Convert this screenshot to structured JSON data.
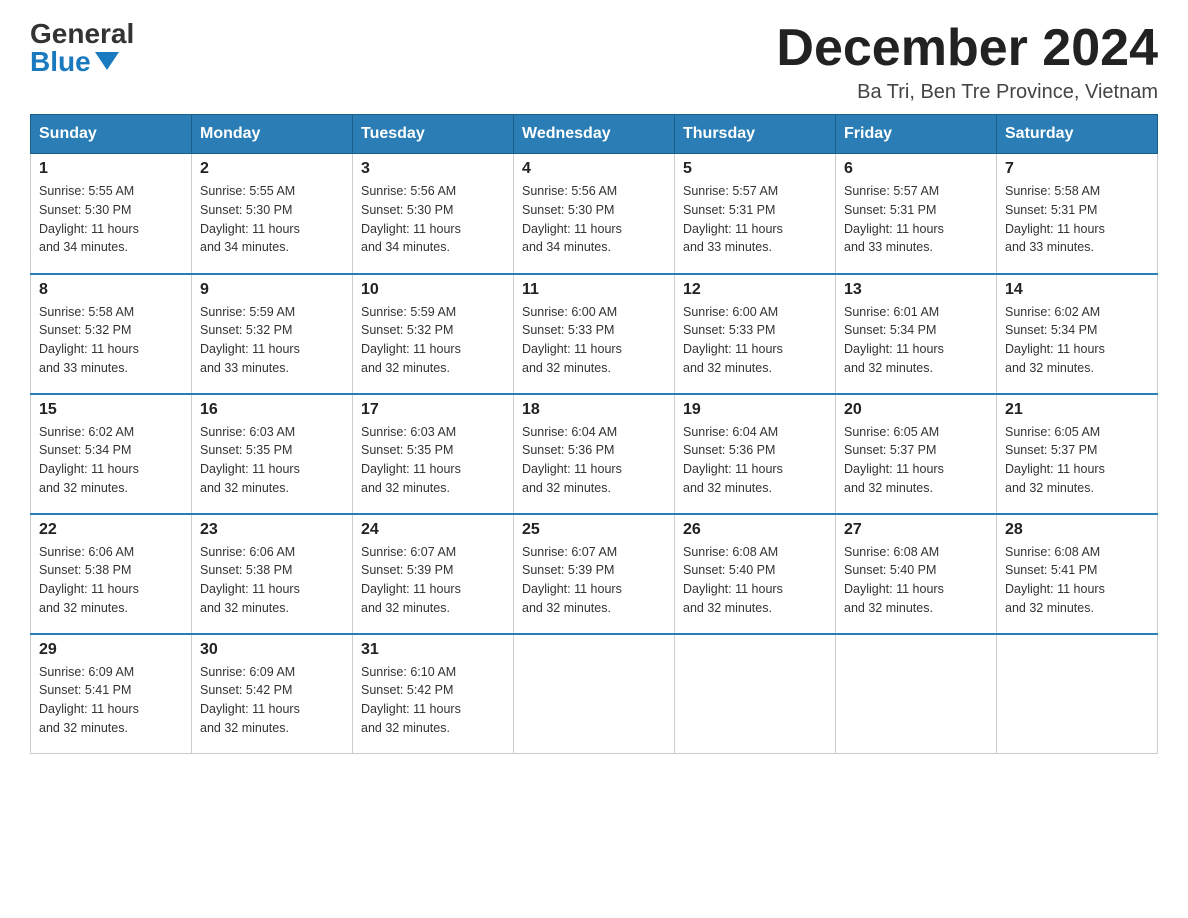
{
  "header": {
    "logo_general": "General",
    "logo_blue": "Blue",
    "month_title": "December 2024",
    "location": "Ba Tri, Ben Tre Province, Vietnam"
  },
  "days_of_week": [
    "Sunday",
    "Monday",
    "Tuesday",
    "Wednesday",
    "Thursday",
    "Friday",
    "Saturday"
  ],
  "weeks": [
    [
      {
        "day": "1",
        "sunrise": "5:55 AM",
        "sunset": "5:30 PM",
        "daylight": "11 hours and 34 minutes."
      },
      {
        "day": "2",
        "sunrise": "5:55 AM",
        "sunset": "5:30 PM",
        "daylight": "11 hours and 34 minutes."
      },
      {
        "day": "3",
        "sunrise": "5:56 AM",
        "sunset": "5:30 PM",
        "daylight": "11 hours and 34 minutes."
      },
      {
        "day": "4",
        "sunrise": "5:56 AM",
        "sunset": "5:30 PM",
        "daylight": "11 hours and 34 minutes."
      },
      {
        "day": "5",
        "sunrise": "5:57 AM",
        "sunset": "5:31 PM",
        "daylight": "11 hours and 33 minutes."
      },
      {
        "day": "6",
        "sunrise": "5:57 AM",
        "sunset": "5:31 PM",
        "daylight": "11 hours and 33 minutes."
      },
      {
        "day": "7",
        "sunrise": "5:58 AM",
        "sunset": "5:31 PM",
        "daylight": "11 hours and 33 minutes."
      }
    ],
    [
      {
        "day": "8",
        "sunrise": "5:58 AM",
        "sunset": "5:32 PM",
        "daylight": "11 hours and 33 minutes."
      },
      {
        "day": "9",
        "sunrise": "5:59 AM",
        "sunset": "5:32 PM",
        "daylight": "11 hours and 33 minutes."
      },
      {
        "day": "10",
        "sunrise": "5:59 AM",
        "sunset": "5:32 PM",
        "daylight": "11 hours and 32 minutes."
      },
      {
        "day": "11",
        "sunrise": "6:00 AM",
        "sunset": "5:33 PM",
        "daylight": "11 hours and 32 minutes."
      },
      {
        "day": "12",
        "sunrise": "6:00 AM",
        "sunset": "5:33 PM",
        "daylight": "11 hours and 32 minutes."
      },
      {
        "day": "13",
        "sunrise": "6:01 AM",
        "sunset": "5:34 PM",
        "daylight": "11 hours and 32 minutes."
      },
      {
        "day": "14",
        "sunrise": "6:02 AM",
        "sunset": "5:34 PM",
        "daylight": "11 hours and 32 minutes."
      }
    ],
    [
      {
        "day": "15",
        "sunrise": "6:02 AM",
        "sunset": "5:34 PM",
        "daylight": "11 hours and 32 minutes."
      },
      {
        "day": "16",
        "sunrise": "6:03 AM",
        "sunset": "5:35 PM",
        "daylight": "11 hours and 32 minutes."
      },
      {
        "day": "17",
        "sunrise": "6:03 AM",
        "sunset": "5:35 PM",
        "daylight": "11 hours and 32 minutes."
      },
      {
        "day": "18",
        "sunrise": "6:04 AM",
        "sunset": "5:36 PM",
        "daylight": "11 hours and 32 minutes."
      },
      {
        "day": "19",
        "sunrise": "6:04 AM",
        "sunset": "5:36 PM",
        "daylight": "11 hours and 32 minutes."
      },
      {
        "day": "20",
        "sunrise": "6:05 AM",
        "sunset": "5:37 PM",
        "daylight": "11 hours and 32 minutes."
      },
      {
        "day": "21",
        "sunrise": "6:05 AM",
        "sunset": "5:37 PM",
        "daylight": "11 hours and 32 minutes."
      }
    ],
    [
      {
        "day": "22",
        "sunrise": "6:06 AM",
        "sunset": "5:38 PM",
        "daylight": "11 hours and 32 minutes."
      },
      {
        "day": "23",
        "sunrise": "6:06 AM",
        "sunset": "5:38 PM",
        "daylight": "11 hours and 32 minutes."
      },
      {
        "day": "24",
        "sunrise": "6:07 AM",
        "sunset": "5:39 PM",
        "daylight": "11 hours and 32 minutes."
      },
      {
        "day": "25",
        "sunrise": "6:07 AM",
        "sunset": "5:39 PM",
        "daylight": "11 hours and 32 minutes."
      },
      {
        "day": "26",
        "sunrise": "6:08 AM",
        "sunset": "5:40 PM",
        "daylight": "11 hours and 32 minutes."
      },
      {
        "day": "27",
        "sunrise": "6:08 AM",
        "sunset": "5:40 PM",
        "daylight": "11 hours and 32 minutes."
      },
      {
        "day": "28",
        "sunrise": "6:08 AM",
        "sunset": "5:41 PM",
        "daylight": "11 hours and 32 minutes."
      }
    ],
    [
      {
        "day": "29",
        "sunrise": "6:09 AM",
        "sunset": "5:41 PM",
        "daylight": "11 hours and 32 minutes."
      },
      {
        "day": "30",
        "sunrise": "6:09 AM",
        "sunset": "5:42 PM",
        "daylight": "11 hours and 32 minutes."
      },
      {
        "day": "31",
        "sunrise": "6:10 AM",
        "sunset": "5:42 PM",
        "daylight": "11 hours and 32 minutes."
      },
      null,
      null,
      null,
      null
    ]
  ],
  "labels": {
    "sunrise": "Sunrise:",
    "sunset": "Sunset:",
    "daylight": "Daylight:"
  }
}
